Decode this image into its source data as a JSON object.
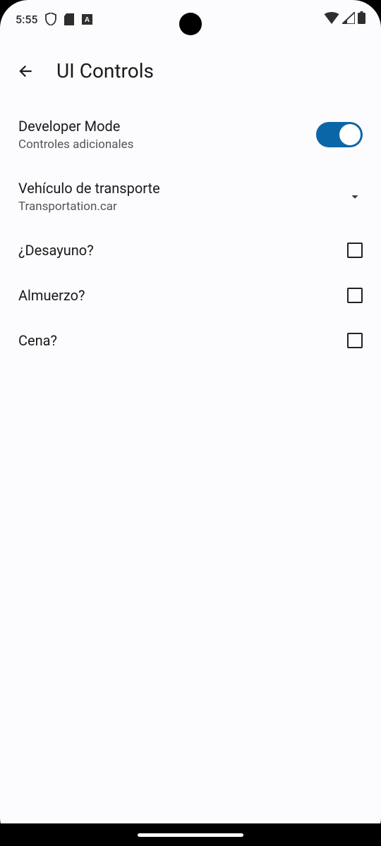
{
  "statusbar": {
    "time": "5:55"
  },
  "appbar": {
    "title": "UI Controls"
  },
  "settings": {
    "developer_mode": {
      "title": "Developer Mode",
      "subtitle": "Controles adicionales",
      "enabled": true
    },
    "transport": {
      "title": "Vehículo de transporte",
      "value": "Transportation.car"
    },
    "breakfast": {
      "label": "¿Desayuno?",
      "checked": false
    },
    "lunch": {
      "label": "Almuerzo?",
      "checked": false
    },
    "dinner": {
      "label": "Cena?",
      "checked": false
    }
  }
}
